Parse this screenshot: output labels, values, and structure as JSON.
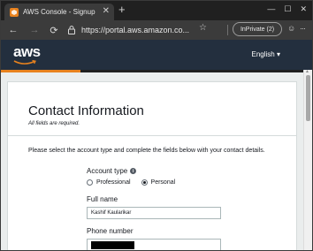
{
  "browser": {
    "tab_title": "AWS Console - Signup",
    "tab_close": "✕",
    "new_tab": "+",
    "window_controls": [
      "—",
      "☐",
      "✕"
    ],
    "back": "←",
    "forward": "→",
    "refresh": "⟳",
    "url": "https://portal.aws.amazon.co...",
    "favorite": "☆",
    "inprivate_label": "InPrivate (2)",
    "emoji_button": "☺",
    "more_button": "···"
  },
  "header": {
    "logo_text": "aws",
    "language": "English ▾"
  },
  "form": {
    "title": "Contact Information",
    "required_note": "All fields are required.",
    "instructions": "Please select the account type and complete the fields below with your contact details.",
    "account_type": {
      "label": "Account type",
      "info_icon": "i",
      "options": [
        {
          "label": "Professional",
          "selected": false
        },
        {
          "label": "Personal",
          "selected": true
        }
      ]
    },
    "full_name": {
      "label": "Full name",
      "value": "Kashif Kaularikar"
    },
    "phone_number": {
      "label": "Phone number",
      "value_redacted": true
    }
  },
  "colors": {
    "aws_header": "#232f3e",
    "aws_orange": "#e8821e",
    "page_bg": "#eaeded"
  }
}
